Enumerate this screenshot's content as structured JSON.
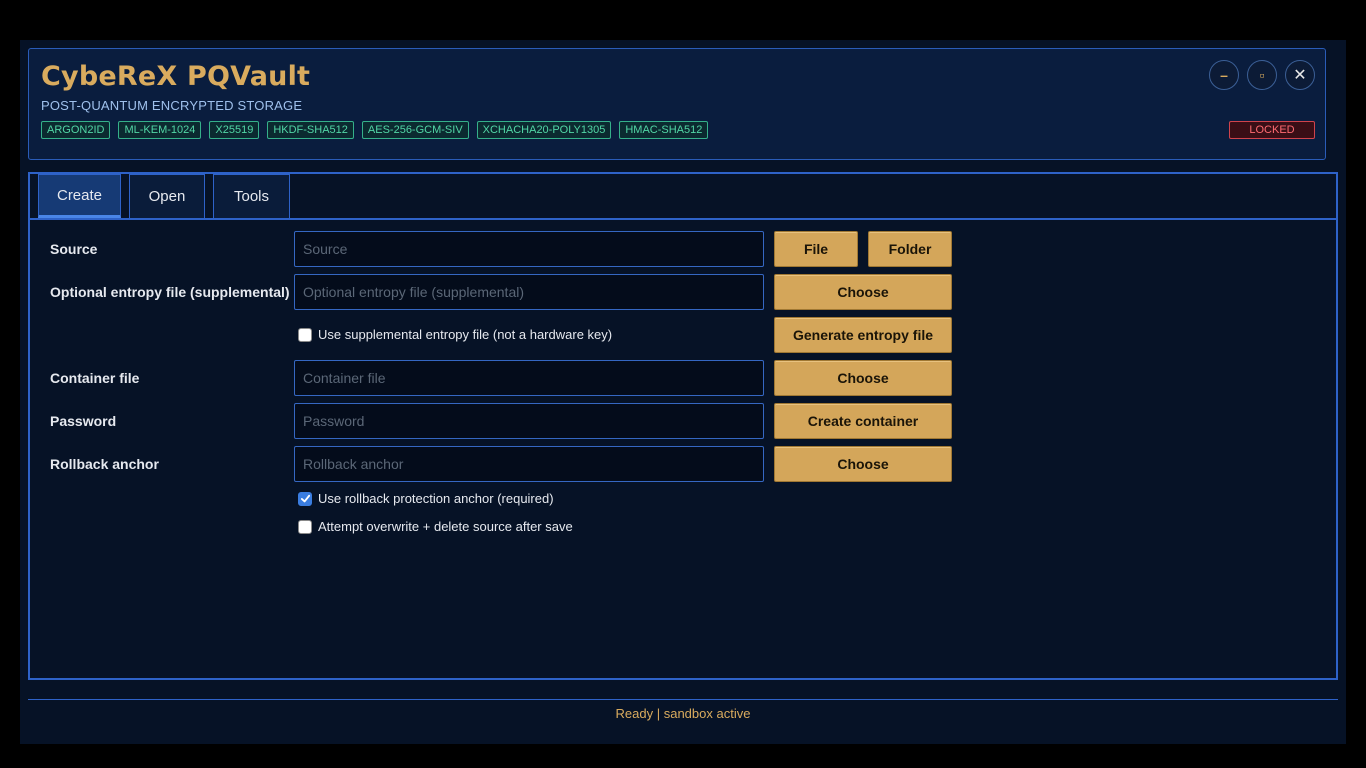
{
  "app": {
    "title": "CybeReX PQVault",
    "subtitle": "POST-QUANTUM ENCRYPTED STORAGE",
    "badges": [
      "ARGON2ID",
      "ML-KEM-1024",
      "X25519",
      "HKDF-SHA512",
      "AES-256-GCM-SIV",
      "XCHACHA20-POLY1305",
      "HMAC-SHA512"
    ],
    "lock_status": "LOCKED",
    "window_controls": {
      "minimize_icon": "–",
      "maximize_icon": "▫",
      "close_icon": "✕"
    }
  },
  "tabs": [
    {
      "label": "Create",
      "active": true
    },
    {
      "label": "Open",
      "active": false
    },
    {
      "label": "Tools",
      "active": false
    }
  ],
  "form": {
    "source": {
      "label": "Source",
      "placeholder": "Source",
      "value": "",
      "file_btn": "File",
      "folder_btn": "Folder"
    },
    "entropy": {
      "label": "Optional entropy file (supplemental)",
      "placeholder": "Optional entropy file (supplemental)",
      "value": "",
      "choose_btn": "Choose"
    },
    "use_entropy": {
      "label": "Use supplemental entropy file (not a hardware key)",
      "checked": false,
      "generate_btn": "Generate entropy file"
    },
    "container": {
      "label": "Container file",
      "placeholder": "Container file",
      "value": "",
      "choose_btn": "Choose"
    },
    "password": {
      "label": "Password",
      "placeholder": "Password",
      "value": "",
      "create_btn": "Create container"
    },
    "rollback": {
      "label": "Rollback anchor",
      "placeholder": "Rollback anchor",
      "value": "",
      "choose_btn": "Choose"
    },
    "use_rollback": {
      "label": "Use rollback protection anchor (required)",
      "checked": true
    },
    "overwrite": {
      "label": "Attempt overwrite + delete source after save",
      "checked": false
    }
  },
  "status": "Ready | sandbox active",
  "colors": {
    "accent_gold": "#d9ab5e",
    "border_blue": "#2e62c8",
    "badge_green": "#52d6a6",
    "locked_red": "#ff6b72",
    "background": "#061226"
  }
}
